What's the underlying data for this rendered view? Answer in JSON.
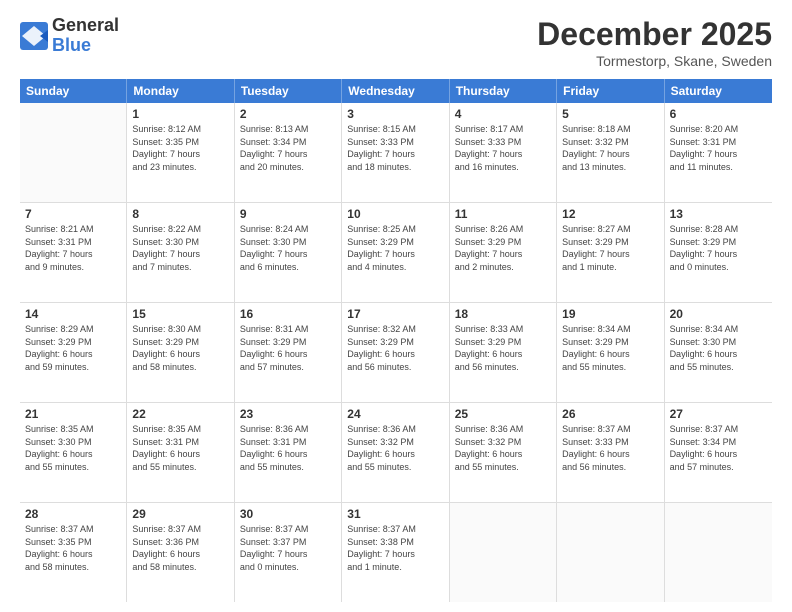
{
  "header": {
    "logo_general": "General",
    "logo_blue": "Blue",
    "month_title": "December 2025",
    "location": "Tormestorp, Skane, Sweden"
  },
  "weekdays": [
    "Sunday",
    "Monday",
    "Tuesday",
    "Wednesday",
    "Thursday",
    "Friday",
    "Saturday"
  ],
  "rows": [
    [
      {
        "day": "",
        "text": ""
      },
      {
        "day": "1",
        "text": "Sunrise: 8:12 AM\nSunset: 3:35 PM\nDaylight: 7 hours\nand 23 minutes."
      },
      {
        "day": "2",
        "text": "Sunrise: 8:13 AM\nSunset: 3:34 PM\nDaylight: 7 hours\nand 20 minutes."
      },
      {
        "day": "3",
        "text": "Sunrise: 8:15 AM\nSunset: 3:33 PM\nDaylight: 7 hours\nand 18 minutes."
      },
      {
        "day": "4",
        "text": "Sunrise: 8:17 AM\nSunset: 3:33 PM\nDaylight: 7 hours\nand 16 minutes."
      },
      {
        "day": "5",
        "text": "Sunrise: 8:18 AM\nSunset: 3:32 PM\nDaylight: 7 hours\nand 13 minutes."
      },
      {
        "day": "6",
        "text": "Sunrise: 8:20 AM\nSunset: 3:31 PM\nDaylight: 7 hours\nand 11 minutes."
      }
    ],
    [
      {
        "day": "7",
        "text": "Sunrise: 8:21 AM\nSunset: 3:31 PM\nDaylight: 7 hours\nand 9 minutes."
      },
      {
        "day": "8",
        "text": "Sunrise: 8:22 AM\nSunset: 3:30 PM\nDaylight: 7 hours\nand 7 minutes."
      },
      {
        "day": "9",
        "text": "Sunrise: 8:24 AM\nSunset: 3:30 PM\nDaylight: 7 hours\nand 6 minutes."
      },
      {
        "day": "10",
        "text": "Sunrise: 8:25 AM\nSunset: 3:29 PM\nDaylight: 7 hours\nand 4 minutes."
      },
      {
        "day": "11",
        "text": "Sunrise: 8:26 AM\nSunset: 3:29 PM\nDaylight: 7 hours\nand 2 minutes."
      },
      {
        "day": "12",
        "text": "Sunrise: 8:27 AM\nSunset: 3:29 PM\nDaylight: 7 hours\nand 1 minute."
      },
      {
        "day": "13",
        "text": "Sunrise: 8:28 AM\nSunset: 3:29 PM\nDaylight: 7 hours\nand 0 minutes."
      }
    ],
    [
      {
        "day": "14",
        "text": "Sunrise: 8:29 AM\nSunset: 3:29 PM\nDaylight: 6 hours\nand 59 minutes."
      },
      {
        "day": "15",
        "text": "Sunrise: 8:30 AM\nSunset: 3:29 PM\nDaylight: 6 hours\nand 58 minutes."
      },
      {
        "day": "16",
        "text": "Sunrise: 8:31 AM\nSunset: 3:29 PM\nDaylight: 6 hours\nand 57 minutes."
      },
      {
        "day": "17",
        "text": "Sunrise: 8:32 AM\nSunset: 3:29 PM\nDaylight: 6 hours\nand 56 minutes."
      },
      {
        "day": "18",
        "text": "Sunrise: 8:33 AM\nSunset: 3:29 PM\nDaylight: 6 hours\nand 56 minutes."
      },
      {
        "day": "19",
        "text": "Sunrise: 8:34 AM\nSunset: 3:29 PM\nDaylight: 6 hours\nand 55 minutes."
      },
      {
        "day": "20",
        "text": "Sunrise: 8:34 AM\nSunset: 3:30 PM\nDaylight: 6 hours\nand 55 minutes."
      }
    ],
    [
      {
        "day": "21",
        "text": "Sunrise: 8:35 AM\nSunset: 3:30 PM\nDaylight: 6 hours\nand 55 minutes."
      },
      {
        "day": "22",
        "text": "Sunrise: 8:35 AM\nSunset: 3:31 PM\nDaylight: 6 hours\nand 55 minutes."
      },
      {
        "day": "23",
        "text": "Sunrise: 8:36 AM\nSunset: 3:31 PM\nDaylight: 6 hours\nand 55 minutes."
      },
      {
        "day": "24",
        "text": "Sunrise: 8:36 AM\nSunset: 3:32 PM\nDaylight: 6 hours\nand 55 minutes."
      },
      {
        "day": "25",
        "text": "Sunrise: 8:36 AM\nSunset: 3:32 PM\nDaylight: 6 hours\nand 55 minutes."
      },
      {
        "day": "26",
        "text": "Sunrise: 8:37 AM\nSunset: 3:33 PM\nDaylight: 6 hours\nand 56 minutes."
      },
      {
        "day": "27",
        "text": "Sunrise: 8:37 AM\nSunset: 3:34 PM\nDaylight: 6 hours\nand 57 minutes."
      }
    ],
    [
      {
        "day": "28",
        "text": "Sunrise: 8:37 AM\nSunset: 3:35 PM\nDaylight: 6 hours\nand 58 minutes."
      },
      {
        "day": "29",
        "text": "Sunrise: 8:37 AM\nSunset: 3:36 PM\nDaylight: 6 hours\nand 58 minutes."
      },
      {
        "day": "30",
        "text": "Sunrise: 8:37 AM\nSunset: 3:37 PM\nDaylight: 7 hours\nand 0 minutes."
      },
      {
        "day": "31",
        "text": "Sunrise: 8:37 AM\nSunset: 3:38 PM\nDaylight: 7 hours\nand 1 minute."
      },
      {
        "day": "",
        "text": ""
      },
      {
        "day": "",
        "text": ""
      },
      {
        "day": "",
        "text": ""
      }
    ]
  ]
}
